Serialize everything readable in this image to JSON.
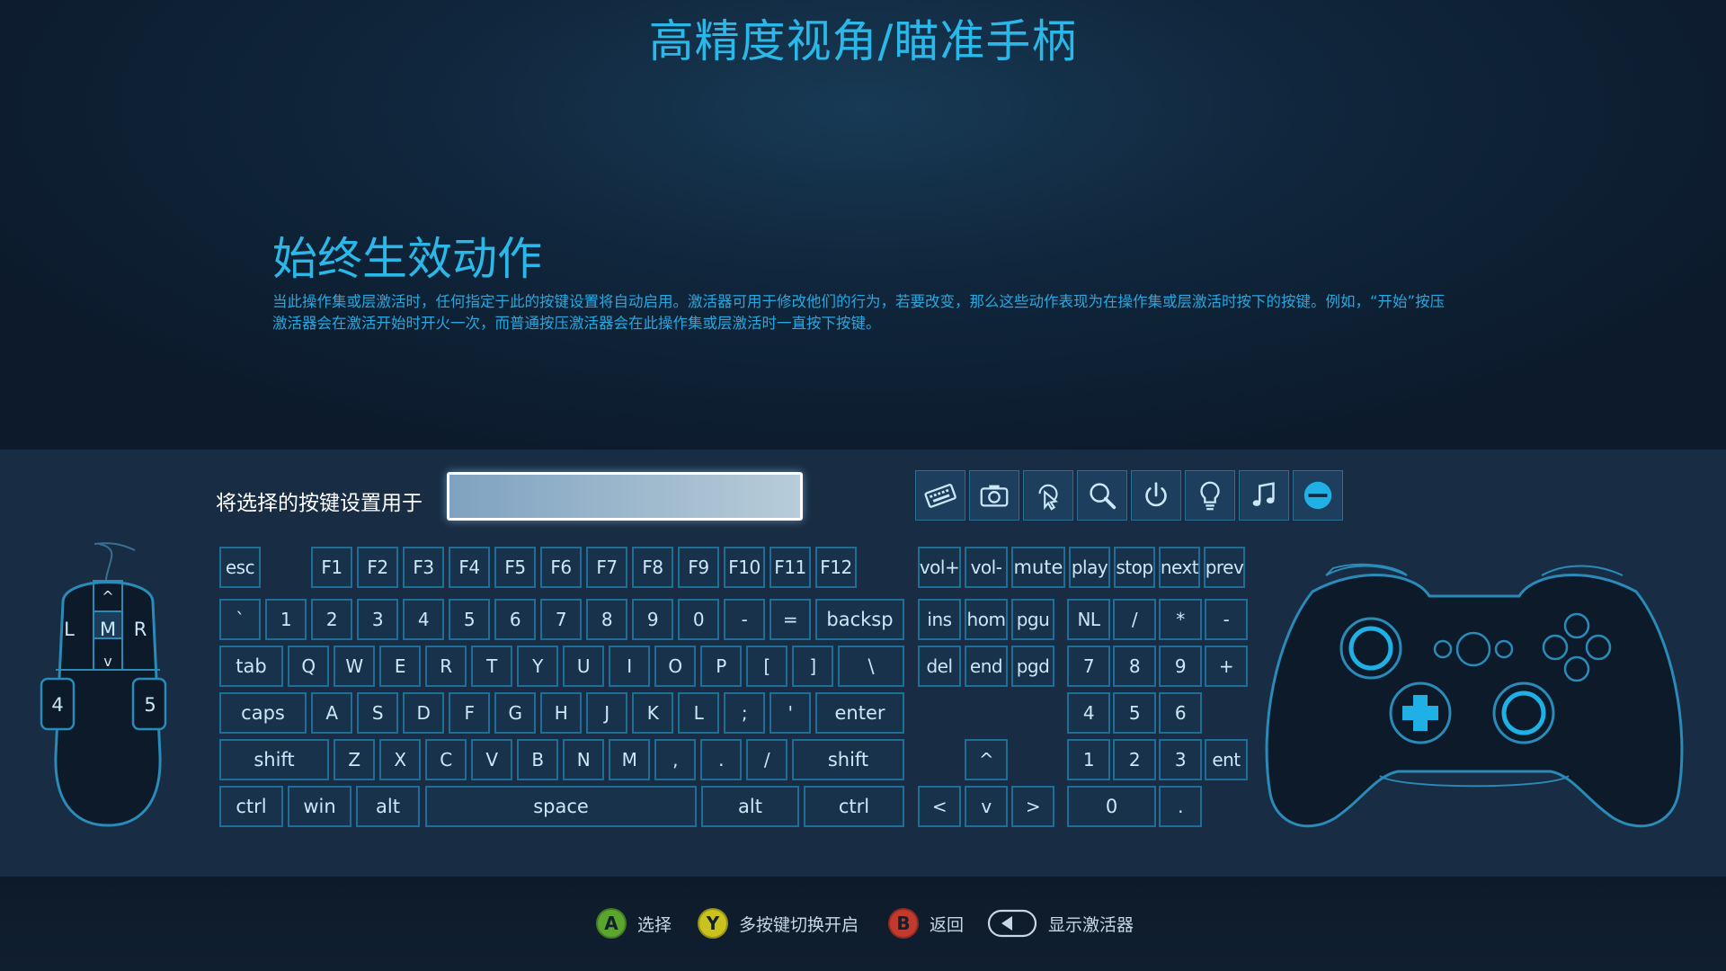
{
  "header": {
    "title": "高精度视角/瞄准手柄"
  },
  "section": {
    "title": "始终生效动作",
    "description": "当此操作集或层激活时，任何指定于此的按键设置将自动启用。激活器可用于修改他们的行为，若要改变，那么这些动作表现为在操作集或层激活时按下的按键。例如，“开始”按压激活器会在激活开始时开火一次，而普通按压激活器会在此操作集或层激活时一直按下按键。"
  },
  "assign": {
    "label": "将选择的按键设置用于",
    "value": ""
  },
  "toolbar": {
    "icons": [
      "keyboard-icon",
      "camera-icon",
      "mouse-pointer-icon",
      "magnifier-icon",
      "power-icon",
      "lightbulb-icon",
      "music-icon",
      "minus-circle-icon"
    ]
  },
  "mouse": {
    "left": "L",
    "middle": "M",
    "right": "R",
    "up": "^",
    "down": "v",
    "b4": "4",
    "b5": "5"
  },
  "keys": {
    "esc": "esc",
    "f1": "F1",
    "f2": "F2",
    "f3": "F3",
    "f4": "F4",
    "f5": "F5",
    "f6": "F6",
    "f7": "F7",
    "f8": "F8",
    "f9": "F9",
    "f10": "F10",
    "f11": "F11",
    "f12": "F12",
    "grave": "`",
    "n1": "1",
    "n2": "2",
    "n3": "3",
    "n4": "4",
    "n5": "5",
    "n6": "6",
    "n7": "7",
    "n8": "8",
    "n9": "9",
    "n0": "0",
    "minus": "-",
    "equal": "=",
    "backsp": "backsp",
    "tab": "tab",
    "q": "Q",
    "w": "W",
    "e": "E",
    "r": "R",
    "t": "T",
    "y": "Y",
    "u": "U",
    "i": "I",
    "o": "O",
    "p": "P",
    "lbracket": "[",
    "rbracket": "]",
    "backslash": "\\",
    "caps": "caps",
    "a": "A",
    "s": "S",
    "d": "D",
    "f": "F",
    "g": "G",
    "h": "H",
    "j": "J",
    "k": "K",
    "l": "L",
    "semicolon": ";",
    "quote": "'",
    "enter": "enter",
    "lshift": "shift",
    "z": "Z",
    "x": "X",
    "c": "C",
    "v": "V",
    "b": "B",
    "n": "N",
    "m": "M",
    "comma": ",",
    "period": ".",
    "slash": "/",
    "rshift": "shift",
    "lctrl": "ctrl",
    "win": "win",
    "lalt": "alt",
    "space": "space",
    "ralt": "alt",
    "rctrl": "ctrl",
    "volup": "vol+",
    "voldown": "vol-",
    "mute": "mute",
    "play": "play",
    "stop": "stop",
    "next": "next",
    "prev": "prev",
    "ins": "ins",
    "home": "hom",
    "pgup": "pgu",
    "del": "del",
    "end": "end",
    "pgdn": "pgd",
    "up": "^",
    "left": "<",
    "down": "v",
    "right": ">",
    "numlock": "NL",
    "npdiv": "/",
    "npmul": "*",
    "npminus": "-",
    "np7": "7",
    "np8": "8",
    "np9": "9",
    "npplus": "+",
    "np4": "4",
    "np5": "5",
    "np6": "6",
    "np1": "1",
    "np2": "2",
    "np3": "3",
    "npenter": "ent",
    "np0": "0",
    "npdot": "."
  },
  "footer": {
    "a": {
      "badge": "A",
      "label": "选择",
      "color": "#5aa52e"
    },
    "y": {
      "badge": "Y",
      "label": "多按键切换开启",
      "color": "#c9c21f"
    },
    "b": {
      "badge": "B",
      "label": "返回",
      "color": "#c23a2e"
    },
    "lb": {
      "label": "显示激活器"
    }
  },
  "colors": {
    "accent": "#2bb8e8",
    "key_border": "#1f6e97",
    "panel": "#182c43"
  }
}
